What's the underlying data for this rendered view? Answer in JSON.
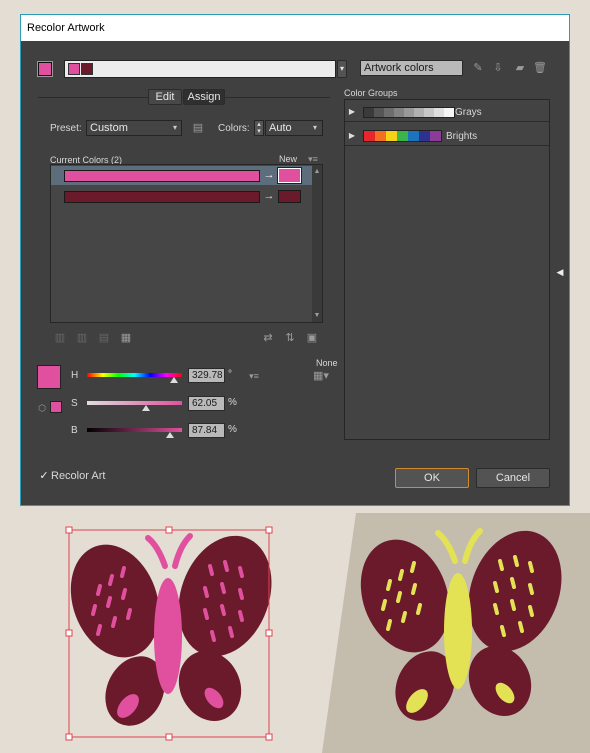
{
  "dialog": {
    "title": "Recolor Artwork",
    "artwork_colors_value": "Artwork colors",
    "tabs": [
      "Edit",
      "Assign"
    ],
    "preset_label": "Preset:",
    "preset_value": "Custom",
    "colors_label": "Colors:",
    "colors_value": "Auto",
    "current_colors_label": "Current Colors (2)",
    "new_label": "New",
    "none_label": "None",
    "color_groups_label": "Color Groups",
    "groups": [
      {
        "name": "Grays",
        "swatches": [
          "#3a3a3a",
          "#555555",
          "#6d6d6d",
          "#838383",
          "#999999",
          "#b0b0b0",
          "#c7c7c7",
          "#dedede",
          "#f5f5f5"
        ]
      },
      {
        "name": "Brights",
        "swatches": [
          "#e8262c",
          "#f36f21",
          "#f7d117",
          "#3ab54a",
          "#1c75bc",
          "#2e3192",
          "#8b3c96"
        ]
      }
    ],
    "current_colors": [
      "#e0509e",
      "#6a1a2b"
    ],
    "hsb": {
      "h_label": "H",
      "h_value": "329.78",
      "h_unit": "°",
      "h_level": 0.916,
      "s_label": "S",
      "s_value": "62.05",
      "s_unit": "%",
      "s_level": 0.62,
      "b_label": "B",
      "b_value": "87.84",
      "b_unit": "%",
      "b_level": 0.878
    },
    "recolor_art_label": "Recolor Art",
    "recolor_art_checked": true,
    "ok_label": "OK",
    "cancel_label": "Cancel",
    "active_color": "#e0509e"
  },
  "colors": {
    "pink": "#e0509e",
    "maroon": "#6a1a2b",
    "yellow": "#e3e255",
    "accent": "#2a9cb8"
  }
}
